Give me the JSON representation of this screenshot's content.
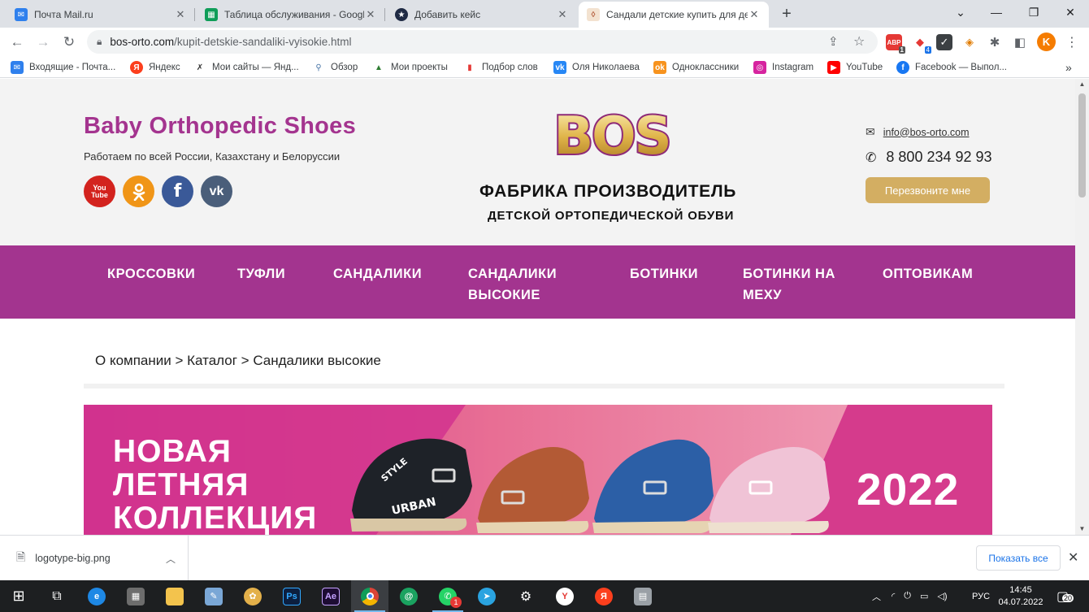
{
  "browser": {
    "tabs": [
      {
        "title": "Почта Mail.ru",
        "icon": "mail-icon",
        "color": "#2f80ed"
      },
      {
        "title": "Таблица обслуживания - Google",
        "icon": "sheets-icon",
        "color": "#0f9d58"
      },
      {
        "title": "Добавить кейс",
        "icon": "star-circle-icon",
        "color": "#1f2a44"
      },
      {
        "title": "Сандали детские купить для дет",
        "icon": "bos-favicon",
        "color": "#c9a06a"
      }
    ],
    "new_tab": "+",
    "url_domain": "bos-orto.com",
    "url_path": "/kupit-detskie-sandaliki-vyisokie.html",
    "profile_letter": "K",
    "ext_badges": {
      "abp": "1",
      "puzzle_a": "4"
    },
    "bookmarks": [
      {
        "label": "Входящие - Почта...",
        "icon": "mail-icon",
        "color": "#2f80ed"
      },
      {
        "label": "Яндекс",
        "icon": "yandex-icon",
        "color": "#fc3f1d"
      },
      {
        "label": "Мои сайты — Янд...",
        "icon": "webmaster-icon",
        "color": "#333333"
      },
      {
        "label": "Обзор",
        "icon": "overview-icon",
        "color": "#4a76a8"
      },
      {
        "label": "Мои проекты",
        "icon": "projects-icon",
        "color": "#2e7d32"
      },
      {
        "label": "Подбор слов",
        "icon": "wordstat-icon",
        "color": "#e53935"
      },
      {
        "label": "Оля Николаева",
        "icon": "vk-icon",
        "color": "#2787f5"
      },
      {
        "label": "Одноклассники",
        "icon": "ok-icon",
        "color": "#f7931e"
      },
      {
        "label": "Instagram",
        "icon": "instagram-icon",
        "color": "#d6249f"
      },
      {
        "label": "YouTube",
        "icon": "youtube-icon",
        "color": "#ff0000"
      },
      {
        "label": "Facebook — Выпол...",
        "icon": "facebook-icon",
        "color": "#1877f2"
      }
    ],
    "more_bookmarks": "»"
  },
  "site": {
    "brand_title": "Baby Orthopedic Shoes",
    "brand_subtitle": "Работаем по всей России, Казахстану и Белоруссии",
    "social": [
      {
        "name": "youtube",
        "glyph": "You Tube",
        "color": "#d3231e"
      },
      {
        "name": "odnoklassniki",
        "glyph": "ок",
        "color": "#f09517"
      },
      {
        "name": "facebook",
        "glyph": "f",
        "color": "#3a5998"
      },
      {
        "name": "vk",
        "glyph": "vk",
        "color": "#4a5e7a"
      }
    ],
    "logo_text": "BOS",
    "factory_line1": "ФАБРИКА ПРОИЗВОДИТЕЛЬ",
    "factory_line2": "ДЕТСКОЙ ОРТОПЕДИЧЕСКОЙ ОБУВИ",
    "email": "info@bos-orto.com",
    "phone": "8 800 234 92 93",
    "callback_label": "Перезвоните мне",
    "nav": [
      {
        "label": "КРОССОВКИ"
      },
      {
        "label": "ТУФЛИ"
      },
      {
        "label": "САНДАЛИКИ"
      },
      {
        "label": "САНДАЛИКИ ВЫСОКИЕ"
      },
      {
        "label": "БОТИНКИ"
      },
      {
        "label": "БОТИНКИ НА МЕХУ"
      },
      {
        "label": "ОПТОВИКАМ"
      }
    ],
    "breadcrumb": [
      "О компании",
      "Каталог",
      "Сандалики высокие"
    ],
    "breadcrumb_sep": " > ",
    "banner": {
      "line1": "НОВАЯ",
      "line2": "ЛЕТНЯЯ",
      "line3": "КОЛЛЕКЦИЯ",
      "year": "2022",
      "shoe_labels": [
        "STYLE",
        "URBAN"
      ]
    },
    "colors": {
      "brand": "#a4348f",
      "accent": "#d3ae62"
    }
  },
  "downloads": {
    "file": "logotype-big.png",
    "show_all": "Показать все"
  },
  "taskbar": {
    "apps": [
      {
        "name": "start",
        "glyph": "⊞"
      },
      {
        "name": "task-view",
        "glyph": "⧉"
      },
      {
        "name": "edge",
        "glyph": "e"
      },
      {
        "name": "calculator",
        "glyph": "▦"
      },
      {
        "name": "explorer",
        "glyph": "▬"
      },
      {
        "name": "notepad",
        "glyph": "✎"
      },
      {
        "name": "paint",
        "glyph": "✿"
      },
      {
        "name": "photoshop",
        "glyph": "Ps"
      },
      {
        "name": "after-effects",
        "glyph": "Ae"
      },
      {
        "name": "chrome",
        "glyph": "◉"
      },
      {
        "name": "email-app",
        "glyph": "@"
      },
      {
        "name": "whatsapp",
        "glyph": "✆"
      },
      {
        "name": "telegram",
        "glyph": "➤"
      },
      {
        "name": "settings",
        "glyph": "⚙"
      },
      {
        "name": "yandex-browser",
        "glyph": "Y"
      },
      {
        "name": "yandex",
        "glyph": "Я"
      },
      {
        "name": "printer",
        "glyph": "▤"
      }
    ],
    "whatsapp_badge": "1",
    "lang": "РУС",
    "time": "14:45",
    "date": "04.07.2022",
    "notifications": "20"
  }
}
